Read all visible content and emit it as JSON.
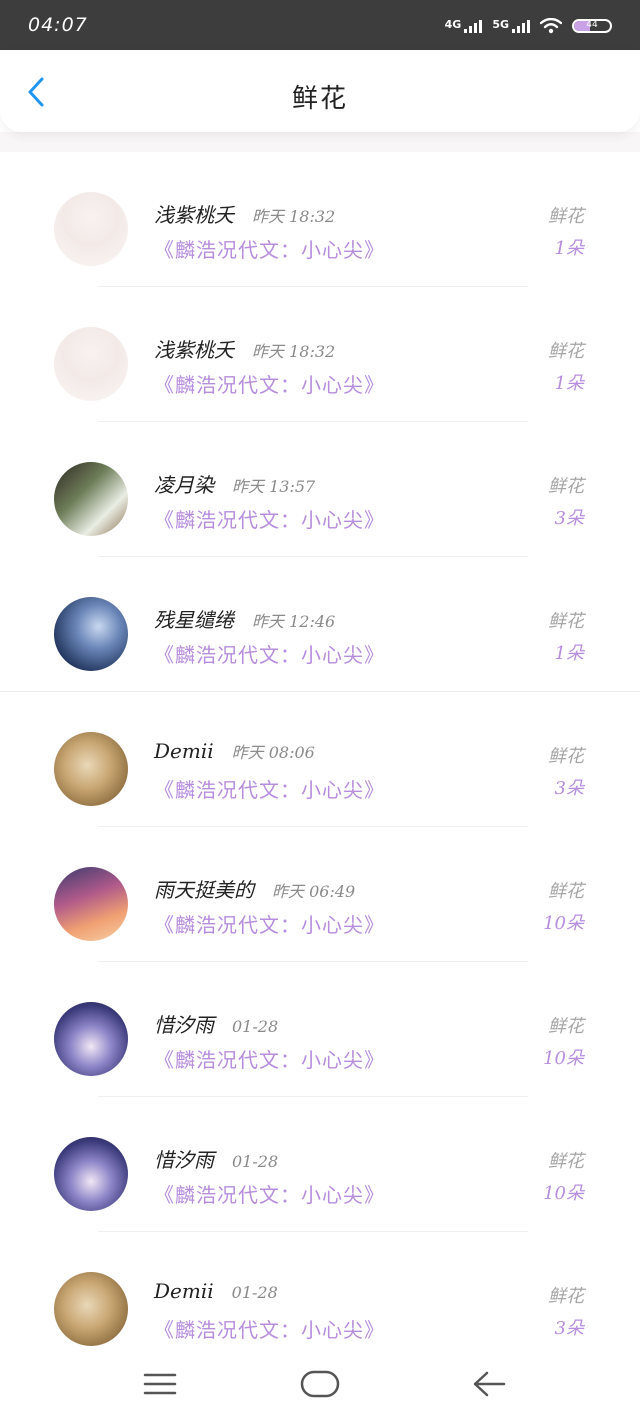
{
  "status_bar": {
    "time": "04:07",
    "network_1": "4G",
    "network_2": "5G",
    "battery": "44",
    "battery_level": 0.44
  },
  "header": {
    "title": "鲜花",
    "back_icon": "chevron-left-icon",
    "accent_color": "#2196f3"
  },
  "list": {
    "items": [
      {
        "name": "浅紫桃夭",
        "time": "昨天 18:32",
        "book": "《麟浩况代文：小心尖》",
        "gift_label": "鲜花",
        "gift_count": "1朵"
      },
      {
        "name": "浅紫桃夭",
        "time": "昨天 18:32",
        "book": "《麟浩况代文：小心尖》",
        "gift_label": "鲜花",
        "gift_count": "1朵"
      },
      {
        "name": "凌月染",
        "time": "昨天 13:57",
        "book": "《麟浩况代文：小心尖》",
        "gift_label": "鲜花",
        "gift_count": "3朵"
      },
      {
        "name": "残星缱绻",
        "time": "昨天 12:46",
        "book": "《麟浩况代文：小心尖》",
        "gift_label": "鲜花",
        "gift_count": "1朵"
      },
      {
        "name": "Demii",
        "time": "昨天 08:06",
        "book": "《麟浩况代文：小心尖》",
        "gift_label": "鲜花",
        "gift_count": "3朵"
      },
      {
        "name": "雨天挺美的",
        "time": "昨天 06:49",
        "book": "《麟浩况代文：小心尖》",
        "gift_label": "鲜花",
        "gift_count": "10朵"
      },
      {
        "name": "惜汐雨",
        "time": "01-28",
        "book": "《麟浩况代文：小心尖》",
        "gift_label": "鲜花",
        "gift_count": "10朵"
      },
      {
        "name": "惜汐雨",
        "time": "01-28",
        "book": "《麟浩况代文：小心尖》",
        "gift_label": "鲜花",
        "gift_count": "10朵"
      },
      {
        "name": "Demii",
        "time": "01-28",
        "book": "《麟浩况代文：小心尖》",
        "gift_label": "鲜花",
        "gift_count": "3朵"
      }
    ]
  },
  "colors": {
    "book_title": "#b78ddd",
    "gift_label": "#a6a6a6"
  },
  "bottom_nav": {
    "menu_icon": "menu-icon",
    "home_icon": "home-icon",
    "back_icon": "arrow-left-icon"
  }
}
